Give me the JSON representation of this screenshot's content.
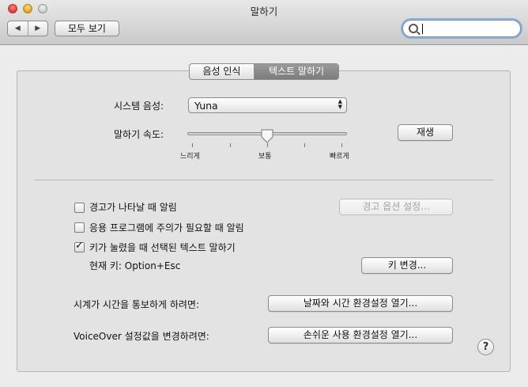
{
  "window": {
    "title": "말하기"
  },
  "toolbar": {
    "back_glyph": "◀",
    "forward_glyph": "▶",
    "show_all_label": "모두 보기",
    "search_placeholder": ""
  },
  "tabs": [
    {
      "label": "음성 인식",
      "selected": false
    },
    {
      "label": "텍스트 말하기",
      "selected": true
    }
  ],
  "voice": {
    "label": "시스템 음성:",
    "selected_value": "Yuna",
    "arrows": "▲▼"
  },
  "rate": {
    "label": "말하기 속도:",
    "level_percent": 50,
    "ticks": [
      "느리게",
      "보통",
      "빠르게"
    ],
    "play_label": "재생"
  },
  "options": {
    "alert_label": "경고가 나타날 때 알림",
    "alert_checked": false,
    "alert_options_button": "경고 옵션 설정...",
    "app_attention_label": "응용 프로그램에 주의가 필요할 때 알림",
    "app_attention_checked": false,
    "speak_selected_label": "키가 눌렸을 때 선택된 텍스트 말하기",
    "speak_selected_checked": true,
    "check_glyph": "✓",
    "current_key_label": "현재 키: Option+Esc",
    "change_key_button": "키 변경..."
  },
  "clock": {
    "label": "시계가 시간을 통보하게 하려면:",
    "button": "날짜와 시간 환경설정 열기..."
  },
  "voiceover": {
    "label": "VoiceOver 설정값을 변경하려면:",
    "button": "손쉬운 사용 환경설정 열기..."
  },
  "help": {
    "glyph": "?"
  },
  "colors": {
    "focus_ring": "#7fb0e6",
    "selected_tab": "#8a8a8a"
  }
}
